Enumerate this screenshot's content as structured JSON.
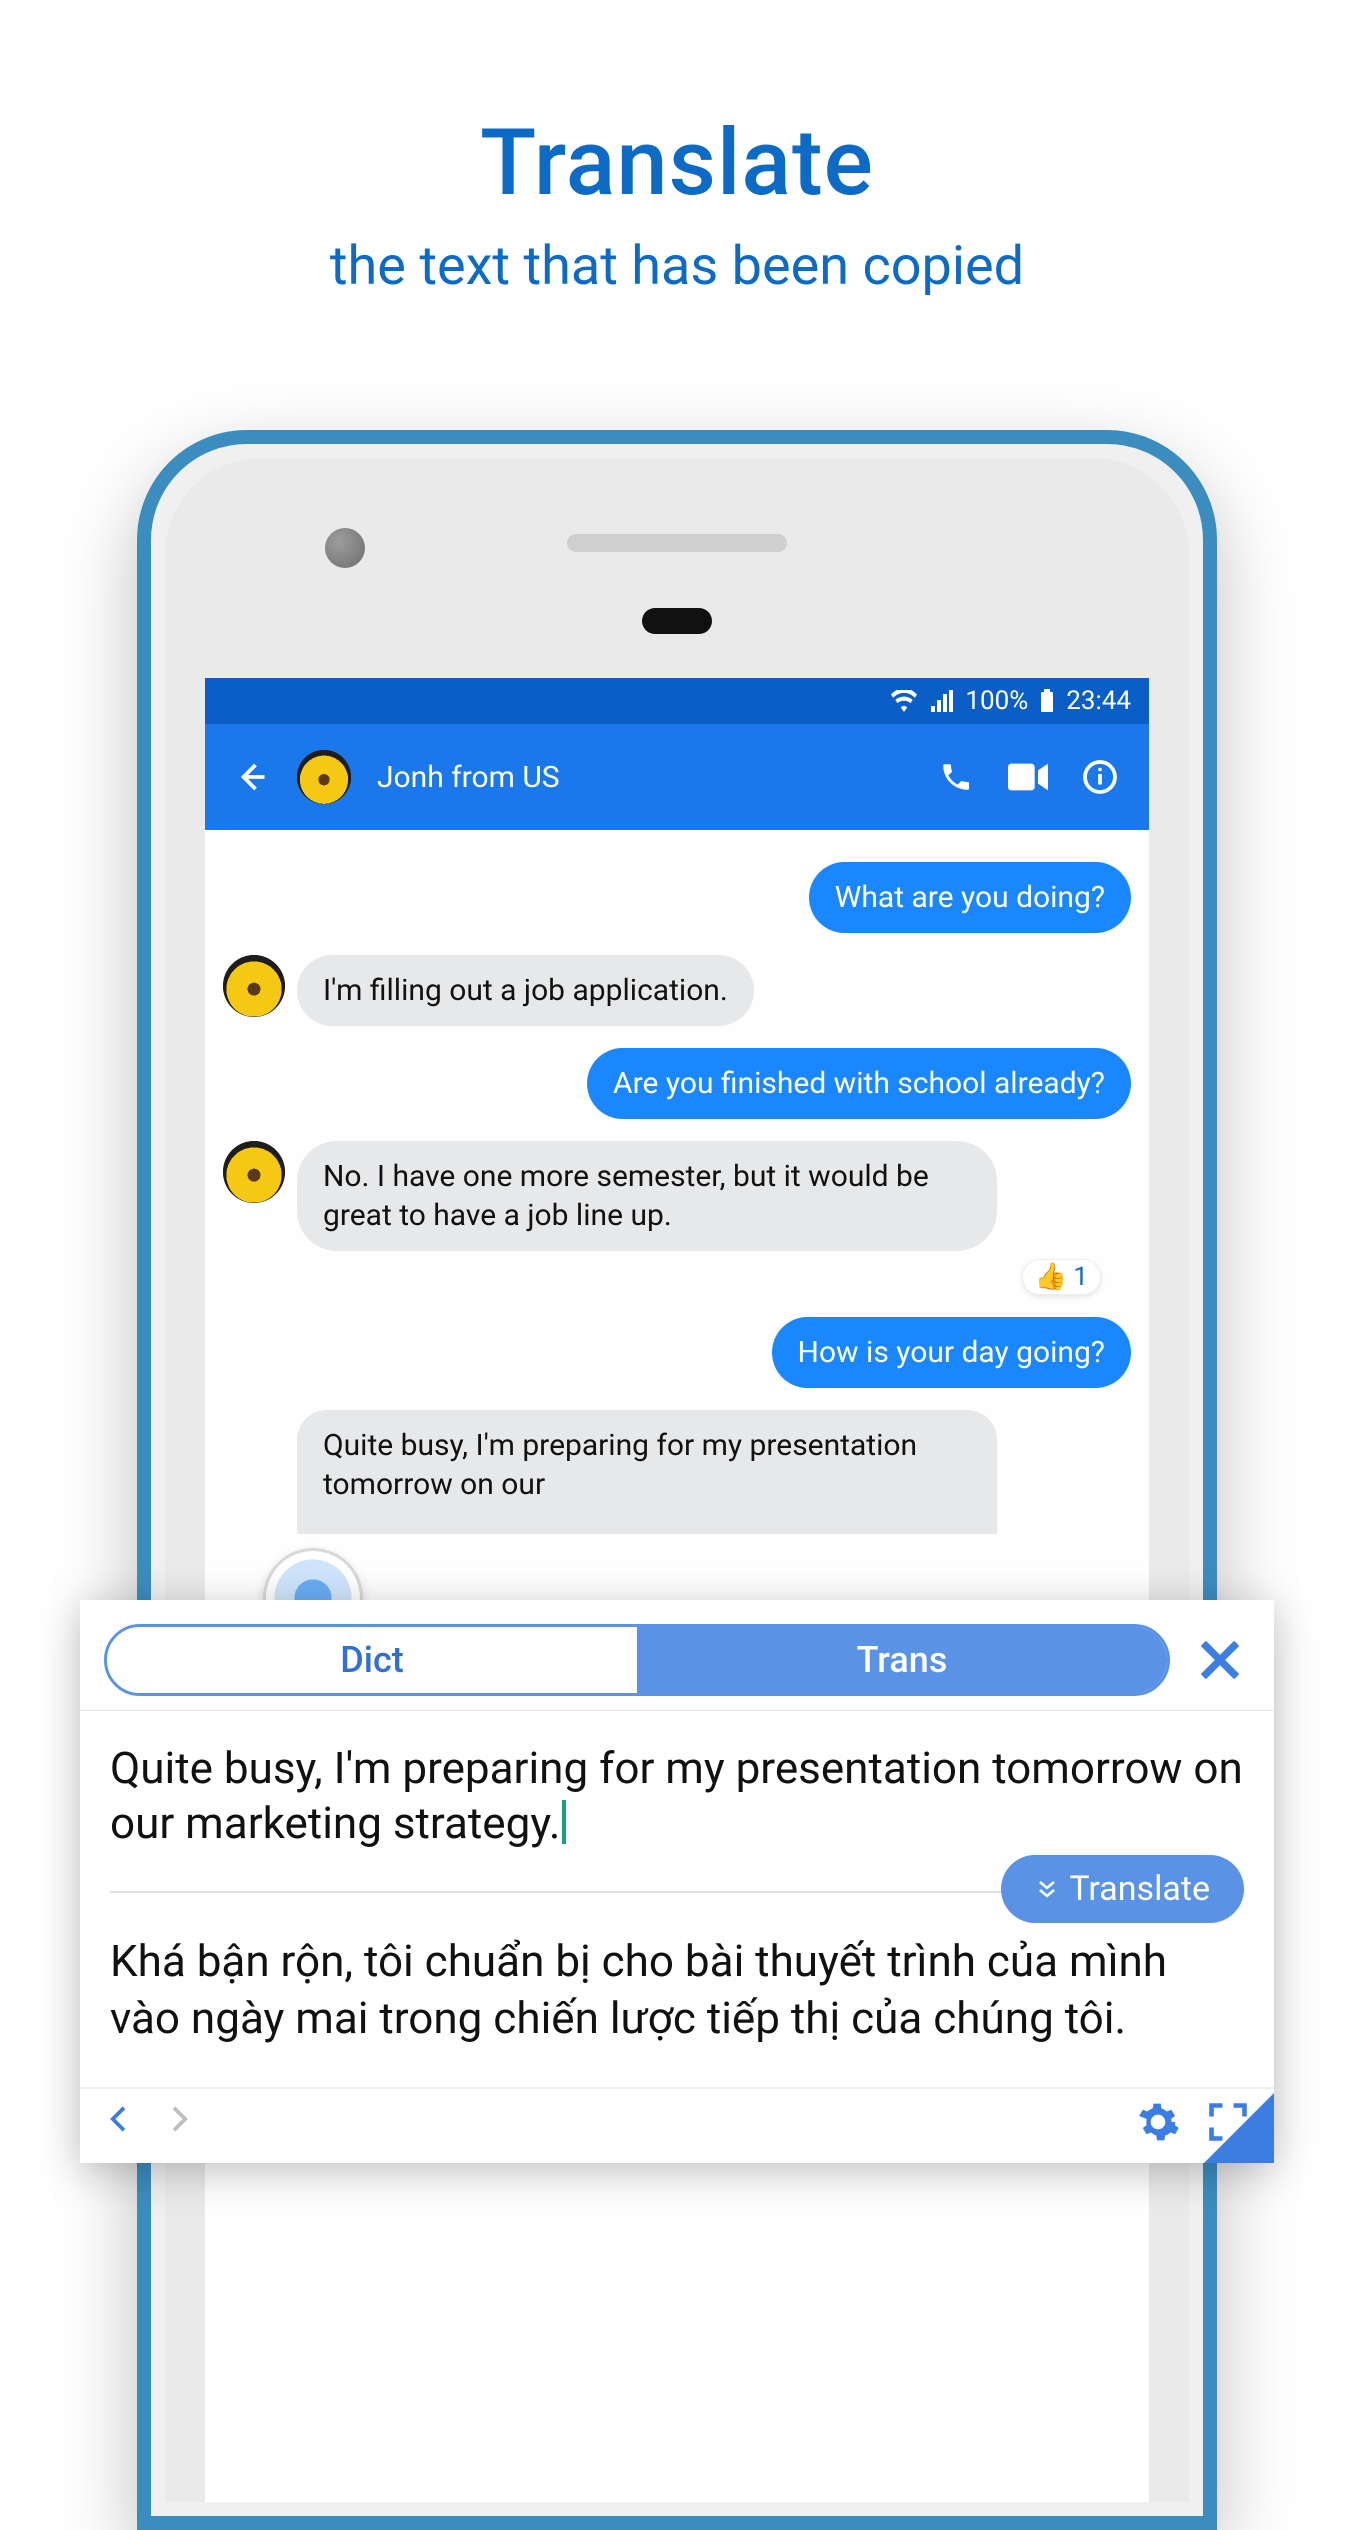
{
  "promo": {
    "title": "Translate",
    "subtitle": "the text that has been copied"
  },
  "status": {
    "battery_pct": "100%",
    "time": "23:44"
  },
  "chat": {
    "contact_name": "Jonh from US",
    "messages": [
      {
        "side": "sent",
        "text": "What are you doing?"
      },
      {
        "side": "recv",
        "text": "I'm filling out a job application."
      },
      {
        "side": "sent",
        "text": "Are you finished with school already?"
      },
      {
        "side": "recv",
        "text": "No. I have one more semester, but it would be great to have a job line up."
      },
      {
        "side": "sent",
        "text": "How is your day going?"
      },
      {
        "side": "recv",
        "text": "Quite busy, I'm preparing for my presentation tomorrow on our"
      }
    ],
    "reaction": {
      "emoji": "👍",
      "count": "1"
    }
  },
  "overlay": {
    "tab_dict": "Dict",
    "tab_trans": "Trans",
    "source": "Quite busy, I'm preparing for my presentation tomorrow on our marketing strategy.",
    "translate_btn": "Translate",
    "result": "Khá bận rộn, tôi chuẩn bị cho bài thuyết trình của mình vào ngày mai trong chiến lược tiếp thị của chúng tôi."
  }
}
